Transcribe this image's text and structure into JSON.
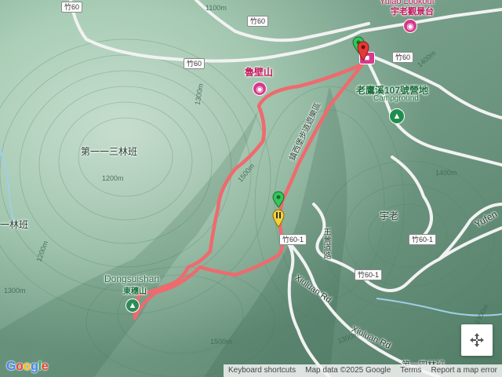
{
  "map": {
    "labels": {
      "lookout_en": "Yulao Lookout",
      "lookout_zh": "宇老觀景台",
      "lubi_shan": "魯壁山",
      "campground_zh": "老鷹溪107號營地",
      "campground_en": "Campground",
      "forest_113": "第一一三林班",
      "forest_side": "一林班",
      "yulao_village": "宇老",
      "yufeng": "Yufen",
      "dongsuishan_en": "Dongsuishan",
      "dongsuishan_zh": "東穗山",
      "trail_name": "鎮西堡步道遊樂區",
      "wangyang_rd": "王鶯道路",
      "xiuluan_rd_1": "Xiuluan Rd",
      "xiuluan_rd_2": "Xiuluan Rd",
      "bottom_forest": "第一四林班"
    },
    "road_shields": [
      "竹60",
      "竹60",
      "竹60",
      "竹60",
      "竹60-1",
      "竹60-1",
      "竹60-1",
      "竹60-1"
    ],
    "contour_labels": [
      "1100m",
      "1200m",
      "1300m",
      "1300m",
      "1400m",
      "1400m",
      "1500m",
      "1500m",
      "1300m",
      "1200m",
      "1300m"
    ],
    "icons": {
      "camera_1": "camera-icon",
      "camera_2": "camera-icon",
      "tent": "tent-icon",
      "hotel": "lodging-icon",
      "peak": "peak-icon",
      "start_pin": "green-pin-icon",
      "end_pin": "red-pin-icon",
      "pause_pin": "pause-pin-icon"
    },
    "colors": {
      "route": "#ef6a6e",
      "terrain_dark": "#6f9f86",
      "terrain_light": "#b9d8c4",
      "road": "#f2f2f2",
      "river": "#9fcfe8",
      "poi": "#c2185b",
      "campground": "#1e8e4e"
    }
  },
  "controls": {
    "fullscreen_icon": "fullscreen-icon"
  },
  "footer": {
    "google": "Google",
    "shortcuts": "Keyboard shortcuts",
    "mapdata": "Map data ©2025 Google",
    "terms": "Terms",
    "report": "Report a map error"
  }
}
